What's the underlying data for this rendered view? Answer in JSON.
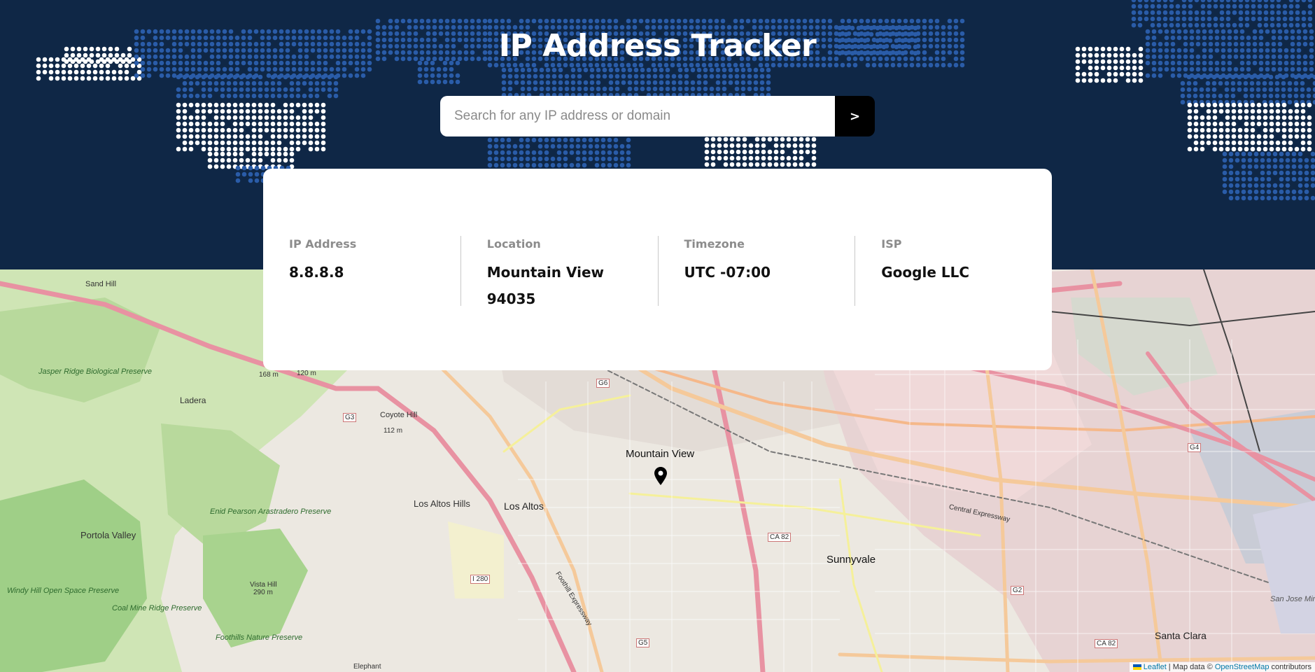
{
  "app": {
    "title": "IP Address Tracker"
  },
  "search": {
    "placeholder": "Search for any IP address or domain",
    "value": "",
    "submit_label": ">"
  },
  "info": {
    "ip_label": "IP Address",
    "ip_value": "8.8.8.8",
    "location_label": "Location",
    "location_value": "Mountain View 94035",
    "timezone_label": "Timezone",
    "timezone_value": "UTC -07:00",
    "isp_label": "ISP",
    "isp_value": "Google LLC"
  },
  "map": {
    "marker_icon": "location-pin-icon",
    "labels": {
      "mountain_view": "Mountain View",
      "sunnyvale": "Sunnyvale",
      "los_altos": "Los Altos",
      "los_altos_hills": "Los Altos Hills",
      "portola_valley": "Portola Valley",
      "ladera": "Ladera",
      "santa_clara": "Santa Clara",
      "sand_hill": "Sand Hill",
      "coyote_hill": "Coyote Hill",
      "coyote_hill_elev": "112 m",
      "vista_hill": "Vista Hill",
      "vista_hill_elev": "290 m",
      "jasper_ridge": "Jasper Ridge Biological Preserve",
      "enid_pearson": "Enid Pearson Arastradero Preserve",
      "windy_hill": "Windy Hill Open Space Preserve",
      "coal_mine": "Coal Mine Ridge Preserve",
      "foothills": "Foothills Nature Preserve",
      "san_jose_airport": "San Jose Mineta International Airport",
      "elephant": "Elephant",
      "i280": "I 280",
      "ca82": "CA 82",
      "ca82b": "CA 82",
      "g6": "G6",
      "g5": "G5",
      "g2": "G2",
      "g3": "G3",
      "g4": "G4",
      "central_expressway": "Central Expressway",
      "foothill_expressway": "Foothill Expressway",
      "elev_120": "120 m",
      "elev_168": "168 m"
    },
    "attribution": {
      "leaflet": "Leaflet",
      "mid": " | Map data © ",
      "osm": "OpenStreetMap",
      "end": " contributors"
    }
  },
  "colors": {
    "header_bg": "#0f2746",
    "dots_blue": "#2a5ca8",
    "dots_white": "#ffffff",
    "search_button": "#000000",
    "accent_link": "#0078a8"
  }
}
